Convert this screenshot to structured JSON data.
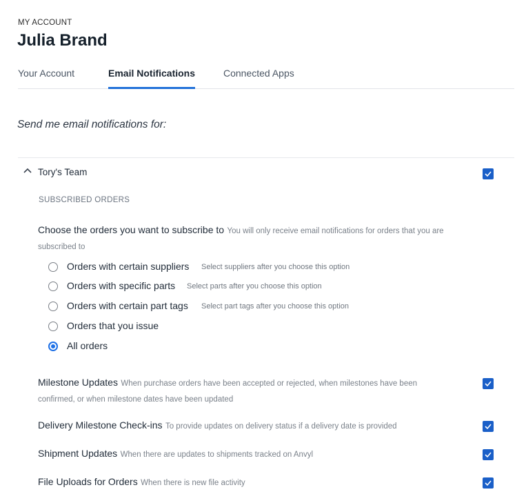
{
  "header": {
    "eyebrow": "MY ACCOUNT",
    "user_name": "Julia Brand"
  },
  "tabs": [
    {
      "label": "Your Account",
      "active": false
    },
    {
      "label": "Email Notifications",
      "active": true
    },
    {
      "label": "Connected Apps",
      "active": false
    }
  ],
  "intro": "Send me email notifications for:",
  "team": {
    "name": "Tory's Team",
    "checked": true,
    "section_label": "SUBSCRIBED ORDERS",
    "choose_title": "Choose the orders you want to subscribe to",
    "choose_hint": "You will only receive email notifications for orders that you are subscribed to",
    "options": [
      {
        "label": "Orders with certain suppliers",
        "hint": "Select suppliers after you choose this option",
        "selected": false
      },
      {
        "label": "Orders with specific parts",
        "hint": "Select parts after you choose this option",
        "selected": false
      },
      {
        "label": "Orders with certain part tags",
        "hint": "Select part tags after you choose this option",
        "selected": false
      },
      {
        "label": "Orders that you issue",
        "hint": "",
        "selected": false
      },
      {
        "label": "All orders",
        "hint": "",
        "selected": true
      }
    ],
    "notifications": [
      {
        "title": "Milestone Updates",
        "hint": "When purchase orders have been accepted or rejected, when milestones have been confirmed, or when milestone dates have been updated",
        "checked": true
      },
      {
        "title": "Delivery Milestone Check-ins",
        "hint": "To provide updates on delivery status if a delivery date is provided",
        "checked": true
      },
      {
        "title": "Shipment Updates",
        "hint": "When there are updates to shipments tracked on Anvyl",
        "checked": true
      },
      {
        "title": "File Uploads for Orders",
        "hint": "When there is new file activity",
        "checked": true
      }
    ]
  },
  "colors": {
    "accent": "#1f6fd8",
    "checkbox": "#1a5fc8",
    "radio": "#1c6fe6"
  }
}
